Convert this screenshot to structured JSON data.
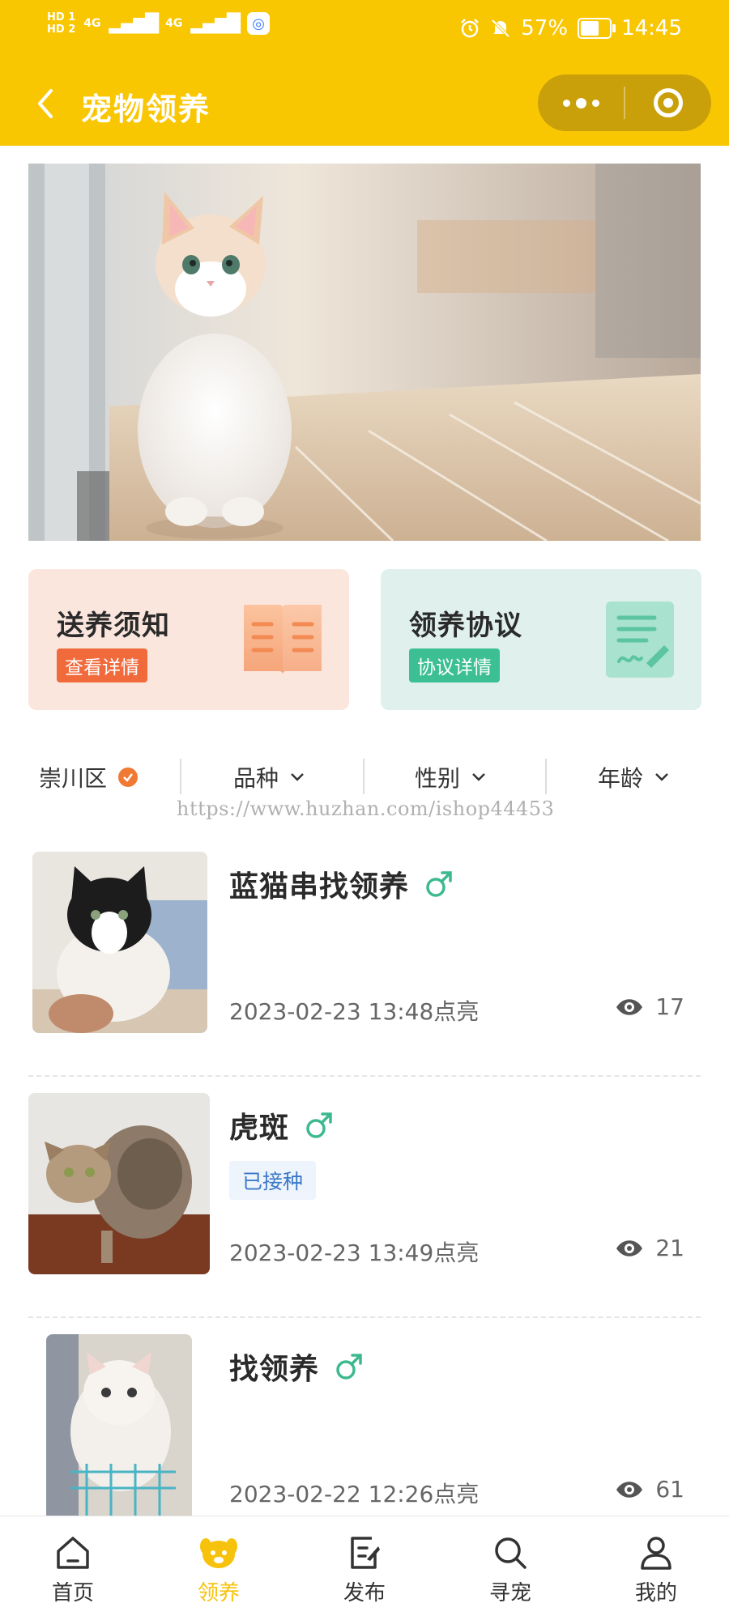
{
  "status_bar": {
    "hd_top": "HD 1",
    "hd_bottom": "HD 2",
    "net1": "4G",
    "net2": "4G",
    "battery": "57%",
    "time": "14:45"
  },
  "nav": {
    "title": "宠物领养"
  },
  "cards": [
    {
      "title": "送养须知",
      "tag": "查看详情",
      "icon": "book-icon"
    },
    {
      "title": "领养协议",
      "tag": "协议详情",
      "icon": "document-sign-icon"
    }
  ],
  "filters": [
    {
      "label": "崇川区",
      "icon": "check-badge-icon"
    },
    {
      "label": "品种",
      "icon": "chevron-down-icon"
    },
    {
      "label": "性别",
      "icon": "chevron-down-icon"
    },
    {
      "label": "年龄",
      "icon": "chevron-down-icon"
    }
  ],
  "watermark": "https://www.huzhan.com/ishop44453",
  "pets": [
    {
      "name": "蓝猫串找领养",
      "gender": "male-icon",
      "tag": "",
      "time": "2023-02-23 13:48点亮",
      "views": "17"
    },
    {
      "name": "虎斑",
      "gender": "male-icon",
      "tag": "已接种",
      "time": "2023-02-23 13:49点亮",
      "views": "21"
    },
    {
      "name": "找领养",
      "gender": "male-icon",
      "tag": "",
      "time": "2023-02-22 12:26点亮",
      "views": "61"
    }
  ],
  "tabbar": {
    "items": [
      {
        "label": "首页",
        "icon": "home-icon"
      },
      {
        "label": "领养",
        "icon": "pet-face-icon",
        "active": true
      },
      {
        "label": "发布",
        "icon": "edit-icon"
      },
      {
        "label": "寻宠",
        "icon": "search-icon"
      },
      {
        "label": "我的",
        "icon": "user-icon"
      }
    ]
  },
  "colors": {
    "brand_yellow": "#f9c602",
    "card1_bg": "#fbe6de",
    "card2_bg": "#dff0ed",
    "accent_orange": "#f06a3c",
    "accent_green": "#3cbf93",
    "male_green": "#3db98f"
  }
}
